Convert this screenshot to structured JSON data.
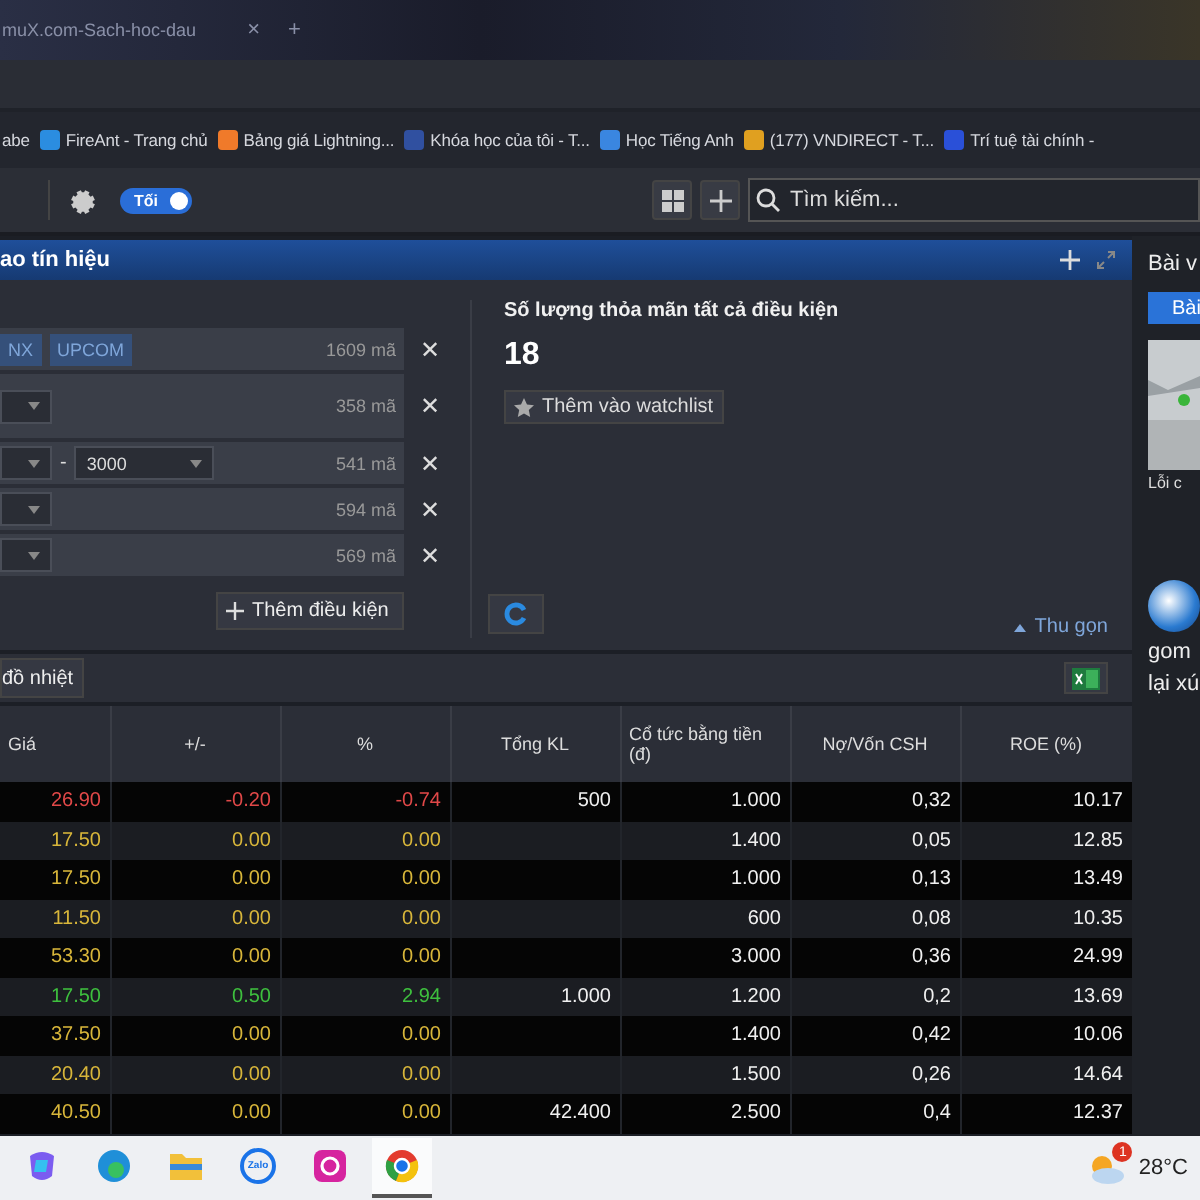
{
  "browser_tab": {
    "title": "muX.com-Sach-hoc-dau",
    "close": "×",
    "new_tab": "+"
  },
  "bookmarks": [
    {
      "label": "abe"
    },
    {
      "label": "FireAnt - Trang chủ",
      "color": "#2b8de0"
    },
    {
      "label": "Bảng giá Lightning...",
      "color": "#f07a2a"
    },
    {
      "label": "Khóa học của tôi - T...",
      "color": "#3050a0"
    },
    {
      "label": "Học Tiếng Anh",
      "color": "#3a86e0"
    },
    {
      "label": "(177) VNDIRECT - T...",
      "color": "#e0a020"
    },
    {
      "label": "Trí tuệ tài chính -",
      "color": "#2a50d8"
    }
  ],
  "toolbar": {
    "toggle": {
      "label": "Tối",
      "on": true
    },
    "search": {
      "placeholder": "Tìm kiếm..."
    }
  },
  "filter_panel": {
    "title": "ao tín hiệu",
    "conditions": [
      {
        "kind": "tags",
        "tags": [
          "NX",
          "UPCOM"
        ],
        "count": "1609 mã"
      },
      {
        "kind": "select",
        "count": "358 mã"
      },
      {
        "kind": "range",
        "to": "3000",
        "separator": "-",
        "count": "541 mã"
      },
      {
        "kind": "select",
        "count": "594 mã"
      },
      {
        "kind": "select",
        "count": "569 mã"
      }
    ],
    "remove": "✕",
    "add_condition": "Thêm điều kiện",
    "result_label": "Số lượng thỏa mãn tất cả điều kiện",
    "result_count": "18",
    "watchlist_button": "Thêm vào watchlist",
    "collapse": "Thu gọn"
  },
  "heatmap_button": "đồ nhiệt",
  "table": {
    "columns": [
      "Giá",
      "+/-",
      "%",
      "Tổng KL",
      "Cổ tức bằng tiền (đ)",
      "Nợ/Vốn CSH",
      "ROE (%)"
    ],
    "rows": [
      {
        "color": "#e04848",
        "cells": [
          "26.90",
          "-0.20",
          "-0.74",
          "500",
          "1.000",
          "0,32",
          "10.17"
        ]
      },
      {
        "color": "#d8b63a",
        "cells": [
          "17.50",
          "0.00",
          "0.00",
          "",
          "1.400",
          "0,05",
          "12.85"
        ]
      },
      {
        "color": "#d8b63a",
        "cells": [
          "17.50",
          "0.00",
          "0.00",
          "",
          "1.000",
          "0,13",
          "13.49"
        ]
      },
      {
        "color": "#d8b63a",
        "cells": [
          "11.50",
          "0.00",
          "0.00",
          "",
          "600",
          "0,08",
          "10.35"
        ]
      },
      {
        "color": "#d8b63a",
        "cells": [
          "53.30",
          "0.00",
          "0.00",
          "",
          "3.000",
          "0,36",
          "24.99"
        ]
      },
      {
        "color": "#3ec03e",
        "cells": [
          "17.50",
          "0.50",
          "2.94",
          "1.000",
          "1.200",
          "0,2",
          "13.69"
        ]
      },
      {
        "color": "#d8b63a",
        "cells": [
          "37.50",
          "0.00",
          "0.00",
          "",
          "1.400",
          "0,42",
          "10.06"
        ]
      },
      {
        "color": "#d8b63a",
        "cells": [
          "20.40",
          "0.00",
          "0.00",
          "",
          "1.500",
          "0,26",
          "14.64"
        ]
      },
      {
        "color": "#d8b63a",
        "cells": [
          "40.50",
          "0.00",
          "0.00",
          "42.400",
          "2.500",
          "0,4",
          "12.37"
        ]
      }
    ]
  },
  "sidebar": {
    "title": "Bài v",
    "tab": "Bài",
    "caption": "Lỗi c",
    "post_lines": [
      "gom",
      "lại xú"
    ]
  },
  "taskbar": {
    "apps": [
      {
        "kind": "copilot",
        "selected": false
      },
      {
        "kind": "edge",
        "selected": false
      },
      {
        "kind": "folder",
        "selected": false
      },
      {
        "kind": "zalo",
        "label": "Zalo",
        "selected": false
      },
      {
        "kind": "instagram",
        "selected": false
      },
      {
        "kind": "chrome",
        "selected": true
      }
    ],
    "weather_badge": "1",
    "temperature": "28°C"
  }
}
